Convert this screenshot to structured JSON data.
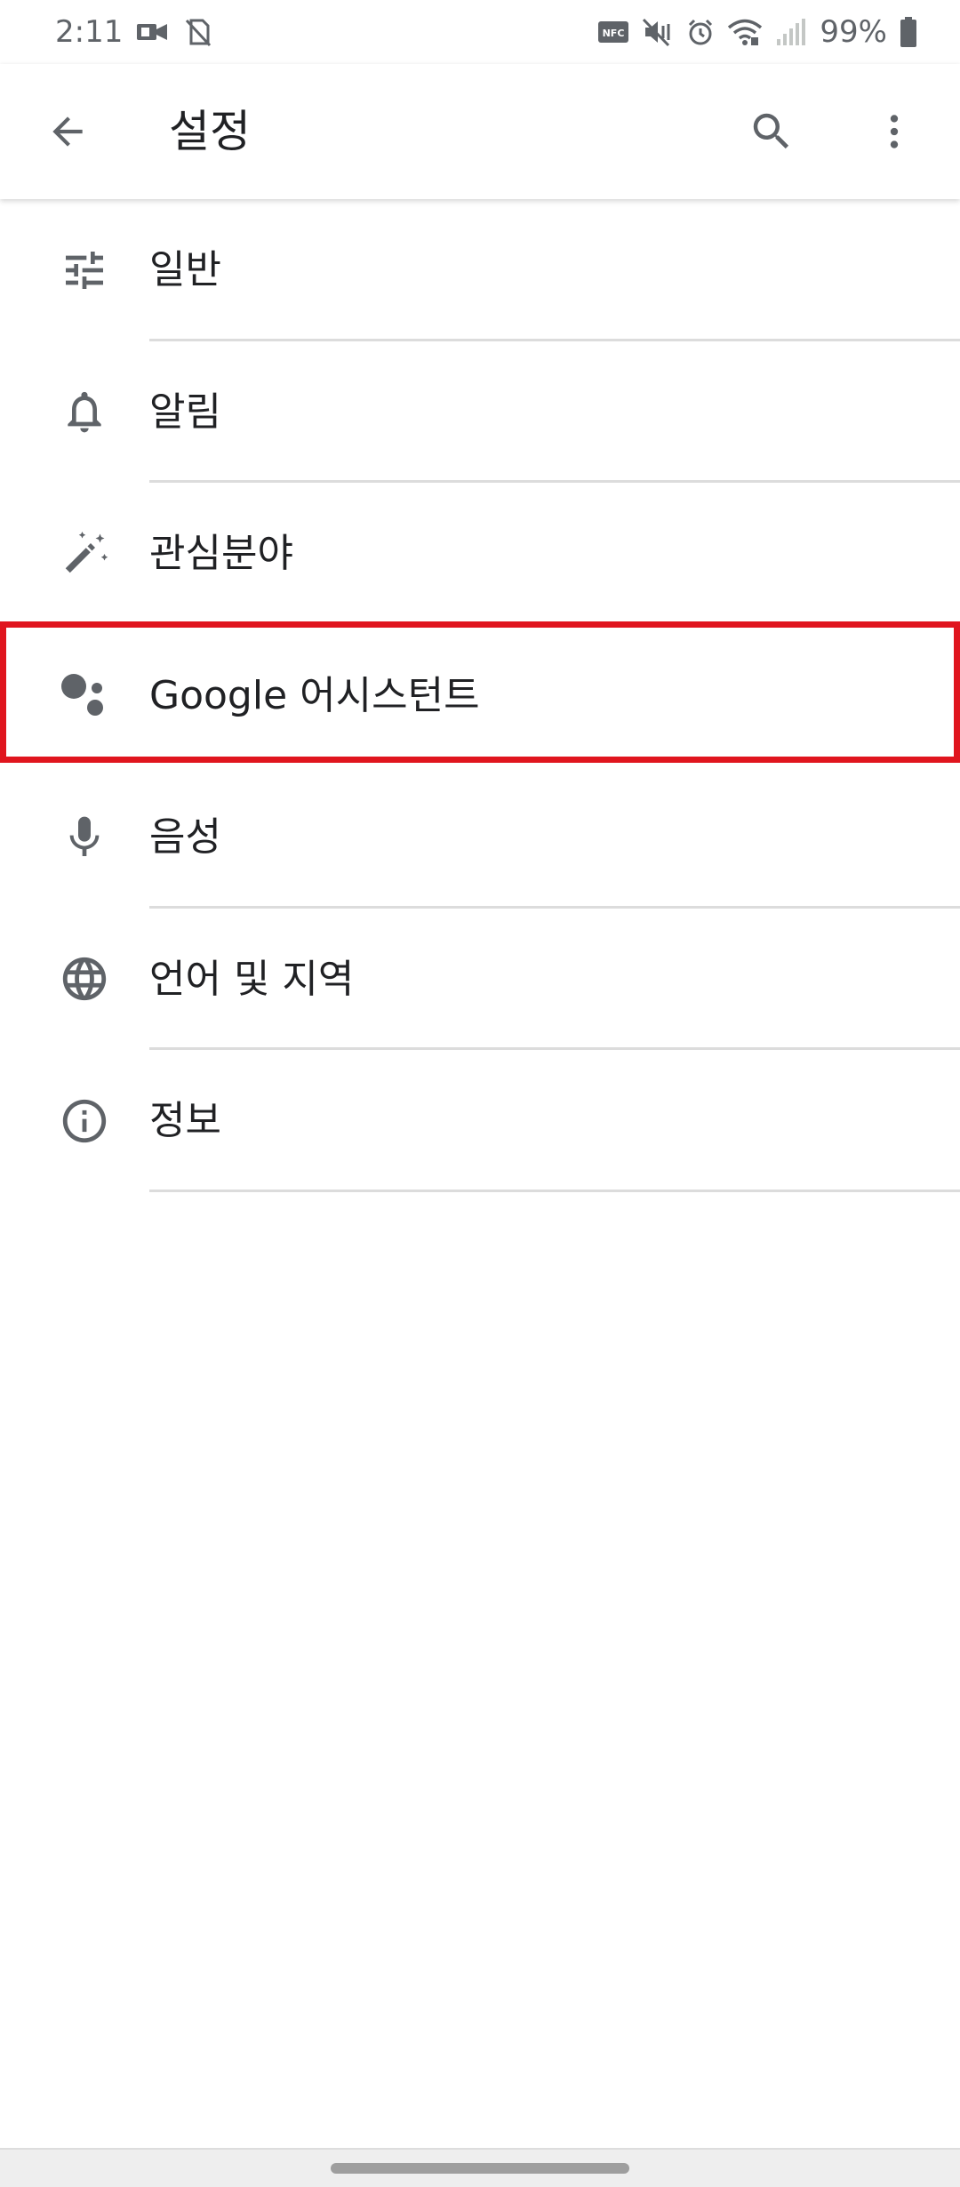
{
  "status_bar": {
    "time": "2:11",
    "battery": "99%",
    "nfc": "NFC"
  },
  "app_bar": {
    "title": "설정"
  },
  "menu": [
    {
      "label": "일반",
      "icon": "tune-icon"
    },
    {
      "label": "알림",
      "icon": "bell-icon"
    },
    {
      "label": "관심분야",
      "icon": "magic-wand-icon"
    },
    {
      "label": "Google 어시스턴트",
      "icon": "google-assistant-icon"
    },
    {
      "label": "음성",
      "icon": "microphone-icon"
    },
    {
      "label": "언어 및 지역",
      "icon": "globe-icon"
    },
    {
      "label": "정보",
      "icon": "info-icon"
    }
  ],
  "colors": {
    "icon": "#5f6368",
    "highlight": "#e0151e",
    "divider": "#dcdcdc"
  }
}
